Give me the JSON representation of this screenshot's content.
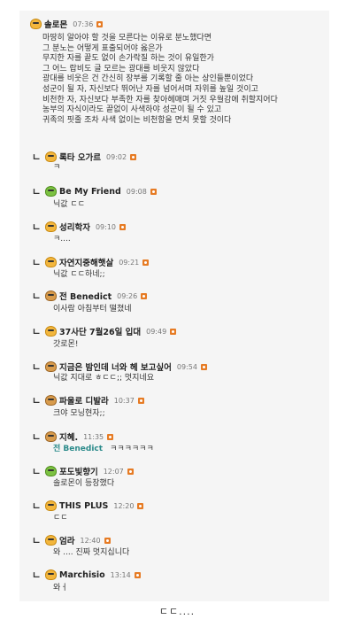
{
  "main_comment": {
    "nick": "솔로몬",
    "time": "07:36",
    "lines": [
      "마땅히 알아야 할 것을 모른다는 이유로 분노했다면",
      "그 분노는 어떻게 표출되어야 옳은가",
      "무지한 자를 끝도 없이 손가락질 하는 것이 유일한가",
      "그 어느 랍비도 글 모르는 광대를 비웃지 않았다",
      "광대를 비웃은 건 간신히 장부를 기록할 줄 아는 상인들뿐이었다",
      "성군이 될 자, 자신보다 뛰어난 자를 넘어서며 자위를 높일 것이고",
      "비천한 자, 자신보다 부족한 자를 찾아헤매며 거짓 우월감에 취할지어다",
      "농부의 자식이라도 끝없이 사색하야 성군이 될 수 있고",
      "귀족의 핏줄 조차 사색 없이는 비천함을 면치 못할 것이다"
    ]
  },
  "replies": [
    {
      "nick": "록타 오가르",
      "time": "09:02",
      "text": "ㅋ",
      "level": "lvl-y"
    },
    {
      "nick": "Be My Friend",
      "time": "09:08",
      "text": "닉값 ㄷㄷ",
      "level": "lvl-g"
    },
    {
      "nick": "성리학자",
      "time": "09:10",
      "text": "ㅋ....",
      "level": "lvl-y"
    },
    {
      "nick": "자연지중해햇살",
      "time": "09:21",
      "text": "닉값 ㄷㄷ하네;;",
      "level": "lvl-y"
    },
    {
      "nick": "전 Benedict",
      "time": "09:26",
      "text": "이사람 아침부터 떨쳤네",
      "level": "lvl-b"
    },
    {
      "nick": "37사단 7월26일 입대",
      "time": "09:49",
      "text": "갓로몬!",
      "level": "lvl-y"
    },
    {
      "nick": "지금은 밤인데 너와 헤 보고싶어",
      "time": "09:54",
      "text": "닉값 지대로 ㅎㄷㄷ;; 멋지네요",
      "level": "lvl-b"
    },
    {
      "nick": "파울로 디발라",
      "time": "10:37",
      "text": "크야 모닝현자;;",
      "level": "lvl-b"
    },
    {
      "nick": "지혜.",
      "time": "11:35",
      "mention": "전 Benedict",
      "text": "ㅋㅋㅋㅋㅋㅋ",
      "level": "lvl-b"
    },
    {
      "nick": "포도빛향기",
      "time": "12:07",
      "text": "솔로몬이 등장했다",
      "level": "lvl-g"
    },
    {
      "nick": "THIS PLUS",
      "time": "12:20",
      "text": "ㄷㄷ",
      "level": "lvl-y"
    },
    {
      "nick": "엄라",
      "time": "12:40",
      "text": "와 .... 진짜 멋지십니다",
      "level": "lvl-y"
    },
    {
      "nick": "Marchisio",
      "time": "13:14",
      "text": "와ㅓ",
      "level": "lvl-y"
    }
  ],
  "reply_arrow": "ㄴ",
  "footer": "ㄷㄷ...."
}
